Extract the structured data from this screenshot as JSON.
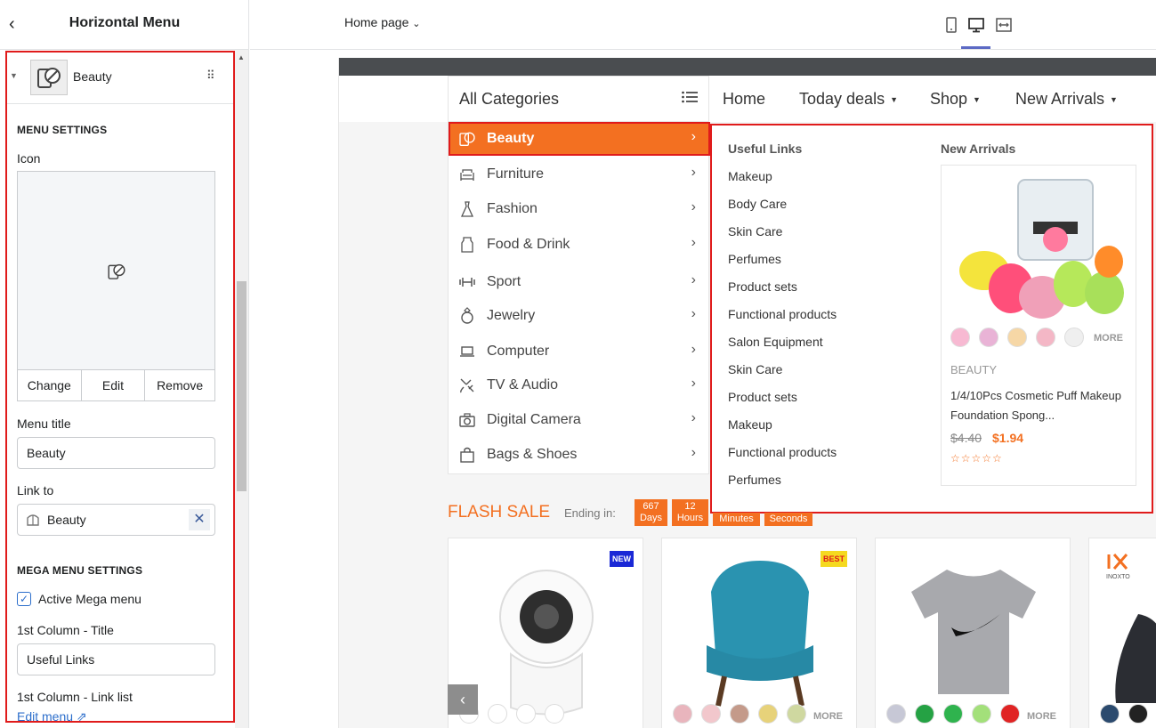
{
  "panel": {
    "title": "Horizontal Menu",
    "block_name": "Beauty",
    "menu_settings_heading": "MENU SETTINGS",
    "icon_label": "Icon",
    "icon_actions": {
      "change": "Change",
      "edit": "Edit",
      "remove": "Remove"
    },
    "menu_title_label": "Menu title",
    "menu_title_value": "Beauty",
    "link_to_label": "Link to",
    "link_to_value": "Beauty",
    "mega_heading": "MEGA MENU SETTINGS",
    "active_mega_label": "Active Mega menu",
    "active_mega_checked": true,
    "col1_title_label": "1st Column - Title",
    "col1_title_value": "Useful Links",
    "col1_links_label": "1st Column - Link list",
    "edit_menu": "Edit menu"
  },
  "topbar": {
    "page_select": "Home page",
    "views": [
      "mobile-icon",
      "desktop-icon",
      "fullwidth-icon"
    ],
    "active_view": "desktop-icon"
  },
  "site": {
    "all_categories": "All Categories",
    "nav": [
      {
        "label": "Home",
        "dropdown": false
      },
      {
        "label": "Today deals",
        "dropdown": true
      },
      {
        "label": "Shop",
        "dropdown": true
      },
      {
        "label": "New Arrivals",
        "dropdown": true
      }
    ],
    "categories": [
      {
        "label": "Beauty",
        "icon": "beauty-icon",
        "active": true
      },
      {
        "label": "Furniture",
        "icon": "sofa-icon"
      },
      {
        "label": "Fashion",
        "icon": "dress-icon"
      },
      {
        "label": "Food & Drink",
        "icon": "milk-icon"
      },
      {
        "label": "Sport",
        "icon": "dumbbell-icon"
      },
      {
        "label": "Jewelry",
        "icon": "ring-icon"
      },
      {
        "label": "Computer",
        "icon": "laptop-icon"
      },
      {
        "label": "TV & Audio",
        "icon": "satellite-icon"
      },
      {
        "label": "Digital Camera",
        "icon": "camera-icon"
      },
      {
        "label": "Bags & Shoes",
        "icon": "bag-icon"
      }
    ],
    "mega": {
      "col1_title": "Useful Links",
      "links": [
        "Makeup",
        "Body Care",
        "Skin Care",
        "Perfumes",
        "Product sets",
        "Functional products",
        "Salon Equipment",
        "Skin Care",
        "Product sets",
        "Makeup",
        "Functional products",
        "Perfumes"
      ],
      "col2_title": "New Arrivals",
      "product": {
        "vendor": "BEAUTY",
        "title": "1/4/10Pcs Cosmetic Puff Makeup Foundation Spong...",
        "old_price": "$4.40",
        "price": "$1.94",
        "more": "MORE",
        "rating_stars": "☆☆☆☆☆"
      }
    },
    "flash": {
      "title": "FLASH SALE",
      "ending_label": "Ending in:",
      "countdown": [
        {
          "value": "667",
          "unit": "Days"
        },
        {
          "value": "12",
          "unit": "Hours"
        },
        {
          "value": "",
          "unit": "Minutes"
        },
        {
          "value": "",
          "unit": "Seconds"
        }
      ]
    },
    "cards": [
      {
        "badge": "NEW",
        "badge_color": "#1a28d6",
        "badge_text_color": "#ffffff",
        "more": ""
      },
      {
        "badge": "BEST",
        "badge_color": "#f5d920",
        "badge_text_color": "#e01b1b",
        "more": "MORE"
      },
      {
        "badge": "",
        "more": "MORE"
      },
      {
        "badge": "",
        "more": "",
        "brand": "INOXTO"
      }
    ]
  },
  "colors": {
    "accent": "#f37021",
    "highlight": "#e01b1b",
    "link": "#2c6ecb"
  }
}
